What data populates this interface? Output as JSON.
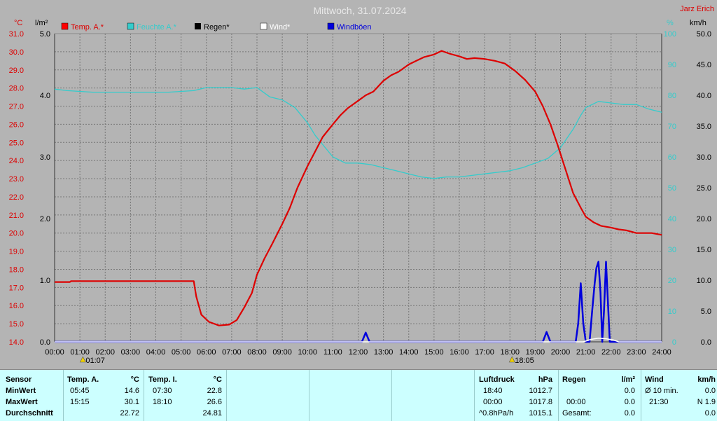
{
  "header": {
    "title": "Mittwoch, 31.07.2024",
    "station": "Jarz Erich"
  },
  "units": {
    "left_temp": "°C",
    "left_rain": "l/m²",
    "right_humid": "%",
    "right_wind": "km/h"
  },
  "legend": [
    {
      "label": "Temp. A.*",
      "color": "#ff0000"
    },
    {
      "label": "Feuchte A.*",
      "color": "#33cccc"
    },
    {
      "label": "Regen*",
      "color": "#000000"
    },
    {
      "label": "Wind*",
      "color": "#ffffff"
    },
    {
      "label": "Windböen",
      "color": "#0000dd"
    }
  ],
  "colors": {
    "temp": "#dd0000",
    "humid": "#33cccc",
    "gust": "#0000dd",
    "wind": "#ffffff",
    "grid": "#777777",
    "bg": "#b4b4b4"
  },
  "markers": {
    "sunrise": "01:07",
    "sunset": "18:05"
  },
  "chart_data": {
    "type": "line",
    "x_ticks": [
      "00:00",
      "01:00",
      "02:00",
      "03:00",
      "04:00",
      "05:00",
      "06:00",
      "07:00",
      "08:00",
      "09:00",
      "10:00",
      "11:00",
      "12:00",
      "13:00",
      "14:00",
      "15:00",
      "16:00",
      "17:00",
      "18:00",
      "19:00",
      "20:00",
      "21:00",
      "22:00",
      "23:00",
      "24:00"
    ],
    "temp_ticks": [
      "31.0",
      "30.0",
      "29.0",
      "28.0",
      "27.0",
      "26.0",
      "25.0",
      "24.0",
      "23.0",
      "22.0",
      "21.0",
      "20.0",
      "19.0",
      "18.0",
      "17.0",
      "16.0",
      "15.0",
      "14.0"
    ],
    "rain_ticks": [
      "5.0",
      "4.0",
      "3.0",
      "2.0",
      "1.0",
      "0.0"
    ],
    "humid_ticks": [
      "100",
      "90",
      "80",
      "70",
      "60",
      "50",
      "40",
      "30",
      "20",
      "10",
      "0"
    ],
    "wind_ticks": [
      "50.0",
      "45.0",
      "40.0",
      "35.0",
      "30.0",
      "25.0",
      "20.0",
      "15.0",
      "10.0",
      "5.0",
      "0.0"
    ],
    "ylim_temp": [
      14,
      31
    ],
    "ylim_rain": [
      0,
      5
    ],
    "ylim_humid": [
      0,
      100
    ],
    "ylim_wind": [
      0,
      50
    ],
    "xlim_hours": [
      0,
      24
    ],
    "series": [
      {
        "name": "Temp. A.*",
        "axis": "temp",
        "points": [
          [
            0,
            17.3
          ],
          [
            0.6,
            17.3
          ],
          [
            0.65,
            17.35
          ],
          [
            5.5,
            17.35
          ],
          [
            5.6,
            16.5
          ],
          [
            5.8,
            15.5
          ],
          [
            6.1,
            15.1
          ],
          [
            6.5,
            14.9
          ],
          [
            6.9,
            14.95
          ],
          [
            7.2,
            15.2
          ],
          [
            7.5,
            15.9
          ],
          [
            7.8,
            16.7
          ],
          [
            8.0,
            17.7
          ],
          [
            8.3,
            18.6
          ],
          [
            8.6,
            19.4
          ],
          [
            9.0,
            20.5
          ],
          [
            9.3,
            21.4
          ],
          [
            9.6,
            22.5
          ],
          [
            10.0,
            23.7
          ],
          [
            10.3,
            24.5
          ],
          [
            10.6,
            25.3
          ],
          [
            11.0,
            26.0
          ],
          [
            11.3,
            26.5
          ],
          [
            11.6,
            26.9
          ],
          [
            12.0,
            27.3
          ],
          [
            12.3,
            27.6
          ],
          [
            12.6,
            27.8
          ],
          [
            13.0,
            28.4
          ],
          [
            13.3,
            28.7
          ],
          [
            13.6,
            28.9
          ],
          [
            14.0,
            29.3
          ],
          [
            14.3,
            29.5
          ],
          [
            14.6,
            29.7
          ],
          [
            15.0,
            29.85
          ],
          [
            15.3,
            30.05
          ],
          [
            15.6,
            29.9
          ],
          [
            16.0,
            29.75
          ],
          [
            16.3,
            29.6
          ],
          [
            16.6,
            29.65
          ],
          [
            17.0,
            29.6
          ],
          [
            17.4,
            29.5
          ],
          [
            17.8,
            29.35
          ],
          [
            18.2,
            28.95
          ],
          [
            18.6,
            28.45
          ],
          [
            19.0,
            27.8
          ],
          [
            19.3,
            27.0
          ],
          [
            19.6,
            26.0
          ],
          [
            19.9,
            24.8
          ],
          [
            20.2,
            23.5
          ],
          [
            20.5,
            22.2
          ],
          [
            20.8,
            21.4
          ],
          [
            21.0,
            20.9
          ],
          [
            21.3,
            20.6
          ],
          [
            21.6,
            20.4
          ],
          [
            22.0,
            20.3
          ],
          [
            22.3,
            20.2
          ],
          [
            22.6,
            20.15
          ],
          [
            23.0,
            20.0
          ],
          [
            23.3,
            20.0
          ],
          [
            23.6,
            20.0
          ],
          [
            24.0,
            19.9
          ]
        ]
      },
      {
        "name": "Feuchte A.*",
        "axis": "humid",
        "points": [
          [
            0,
            82
          ],
          [
            0.5,
            81.5
          ],
          [
            1.5,
            81
          ],
          [
            3.0,
            81
          ],
          [
            4.5,
            81
          ],
          [
            5.5,
            81.5
          ],
          [
            6.0,
            82.5
          ],
          [
            6.5,
            82.5
          ],
          [
            7.0,
            82.5
          ],
          [
            7.5,
            82
          ],
          [
            8.0,
            82.5
          ],
          [
            8.5,
            79.5
          ],
          [
            9.0,
            78.5
          ],
          [
            9.5,
            76
          ],
          [
            10.0,
            71
          ],
          [
            10.3,
            67
          ],
          [
            10.6,
            64
          ],
          [
            11.0,
            60
          ],
          [
            11.5,
            58
          ],
          [
            12.0,
            58
          ],
          [
            12.5,
            57.5
          ],
          [
            13.0,
            56.5
          ],
          [
            13.5,
            55.5
          ],
          [
            14.0,
            54.5
          ],
          [
            14.5,
            53.5
          ],
          [
            15.0,
            53
          ],
          [
            15.5,
            53.5
          ],
          [
            16.0,
            53.5
          ],
          [
            16.5,
            54
          ],
          [
            17.0,
            54.5
          ],
          [
            17.5,
            55
          ],
          [
            18.0,
            55.5
          ],
          [
            18.5,
            56.5
          ],
          [
            19.0,
            58
          ],
          [
            19.5,
            59.5
          ],
          [
            20.0,
            63
          ],
          [
            20.5,
            69
          ],
          [
            20.8,
            73.5
          ],
          [
            21.0,
            76
          ],
          [
            21.5,
            78
          ],
          [
            22.0,
            77.5
          ],
          [
            22.5,
            77
          ],
          [
            23.0,
            77
          ],
          [
            23.5,
            75.5
          ],
          [
            24.0,
            74.5
          ]
        ]
      },
      {
        "name": "Windböen",
        "axis": "wind",
        "points": [
          [
            0,
            0
          ],
          [
            12.15,
            0
          ],
          [
            12.3,
            1.5
          ],
          [
            12.45,
            0
          ],
          [
            19.3,
            0
          ],
          [
            19.45,
            1.6
          ],
          [
            19.6,
            0
          ],
          [
            20.6,
            0
          ],
          [
            20.7,
            3.0
          ],
          [
            20.8,
            9.5
          ],
          [
            20.9,
            3.0
          ],
          [
            21.0,
            0
          ],
          [
            21.15,
            0
          ],
          [
            21.25,
            5.0
          ],
          [
            21.35,
            9.5
          ],
          [
            21.42,
            12.0
          ],
          [
            21.5,
            13.0
          ],
          [
            21.58,
            8.0
          ],
          [
            21.65,
            0
          ],
          [
            21.72,
            5.0
          ],
          [
            21.8,
            13.0
          ],
          [
            21.88,
            6.0
          ],
          [
            21.95,
            0
          ],
          [
            24.0,
            0
          ]
        ]
      },
      {
        "name": "Wind*",
        "axis": "wind",
        "points": [
          [
            0,
            0
          ],
          [
            20.9,
            0
          ],
          [
            21.2,
            0.4
          ],
          [
            21.5,
            0.6
          ],
          [
            21.8,
            0.5
          ],
          [
            22.1,
            0.3
          ],
          [
            22.3,
            0
          ],
          [
            24.0,
            0
          ]
        ]
      }
    ]
  },
  "stats": {
    "sensor": {
      "header": "Sensor",
      "rows": [
        "MinWert",
        "MaxWert",
        "Durchschnitt"
      ]
    },
    "temp_a": {
      "header": "Temp. A.",
      "unit": "°C",
      "rows": [
        {
          "time": "05:45",
          "value": "14.6"
        },
        {
          "time": "15:15",
          "value": "30.1"
        },
        {
          "time": "",
          "value": "22.72"
        }
      ]
    },
    "temp_i": {
      "header": "Temp. I.",
      "unit": "°C",
      "rows": [
        {
          "time": "07:30",
          "value": "22.8"
        },
        {
          "time": "18:10",
          "value": "26.6"
        },
        {
          "time": "",
          "value": "24.81"
        }
      ]
    },
    "luftdruck": {
      "header": "Luftdruck",
      "unit": "hPa",
      "rows": [
        {
          "time": "18:40",
          "value": "1012.7"
        },
        {
          "time": "00:00",
          "value": "1017.8"
        },
        {
          "time": "^0.8hPa/h",
          "value": "1015.1"
        }
      ]
    },
    "regen": {
      "header": "Regen",
      "unit": "l/m²",
      "rows": [
        {
          "time": "",
          "value": "0.0"
        },
        {
          "time": "00:00",
          "value": "0.0"
        },
        {
          "time": "Gesamt:",
          "value": "0.0"
        }
      ]
    },
    "wind": {
      "header": "Wind",
      "unit": "km/h",
      "rows": [
        {
          "time": "Ø 10 min.",
          "value": "0.0"
        },
        {
          "time": "21:30",
          "value": "N 1.9"
        },
        {
          "time": "",
          "value": "0.0"
        }
      ]
    }
  }
}
